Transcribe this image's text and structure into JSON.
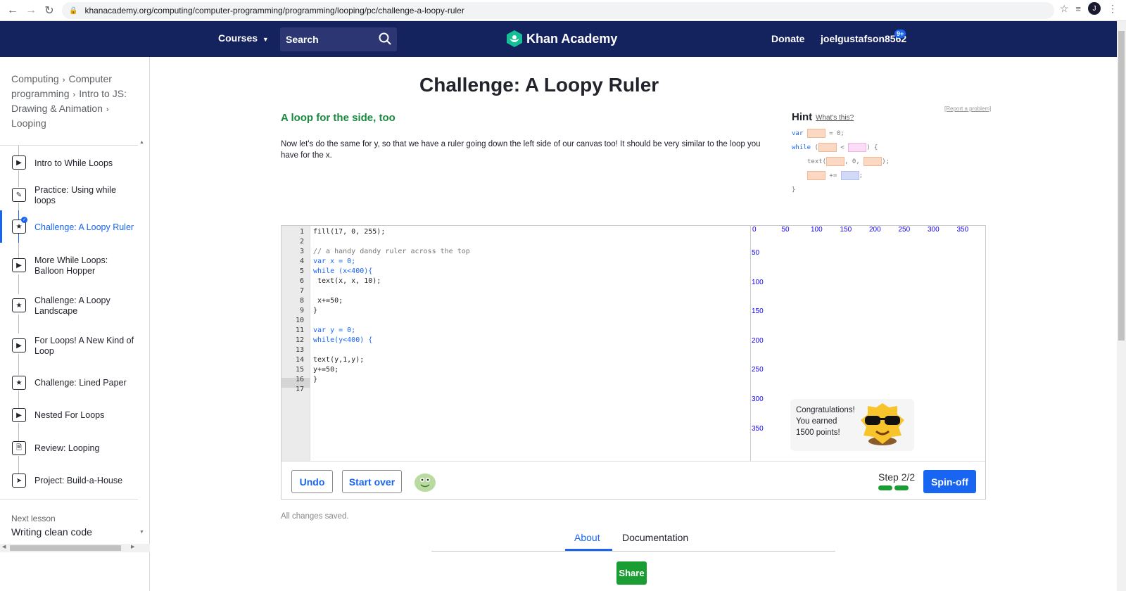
{
  "browser": {
    "url": "khanacademy.org/computing/computer-programming/programming/looping/pc/challenge-a-loopy-ruler",
    "profile_initial": "J"
  },
  "header": {
    "courses": "Courses",
    "search_placeholder": "Search",
    "logo": "Khan Academy",
    "donate": "Donate",
    "username": "joelgustafson8562",
    "notif_count": "9+"
  },
  "sidebar": {
    "breadcrumb": [
      "Computing",
      "Computer programming",
      "Intro to JS: Drawing & Animation",
      "Looping"
    ],
    "items": [
      {
        "label": "Intro to While Loops",
        "icon": "play-icon"
      },
      {
        "label": "Practice: Using while loops",
        "icon": "pencil-icon"
      },
      {
        "label": "Challenge: A Loopy Ruler",
        "icon": "star-icon"
      },
      {
        "label": "More While Loops: Balloon Hopper",
        "icon": "play-icon"
      },
      {
        "label": "Challenge: A Loopy Landscape",
        "icon": "star-icon"
      },
      {
        "label": "For Loops! A New Kind of Loop",
        "icon": "play-icon"
      },
      {
        "label": "Challenge: Lined Paper",
        "icon": "star-icon"
      },
      {
        "label": "Nested For Loops",
        "icon": "play-icon"
      },
      {
        "label": "Review: Looping",
        "icon": "document-icon"
      },
      {
        "label": "Project: Build-a-House",
        "icon": "rocket-icon"
      }
    ],
    "next_label": "Next lesson",
    "next_title": "Writing clean code"
  },
  "main": {
    "title": "Challenge: A Loopy Ruler",
    "subtitle": "A loop for the side, too",
    "description": "Now let's do the same for y, so that we have a ruler going down the left side of our canvas too! It should be very similar to the loop you have for the x.",
    "report": "[Report a problem]",
    "hint_title": "Hint",
    "hint_what": "What's this?",
    "hint_lines": {
      "l1_kw": "var",
      "l1_eq": "= 0;",
      "l2_kw": "while",
      "l2_open": "(",
      "l2_lt": "<",
      "l2_close": ") {",
      "l3_fn": "text(",
      "l3_mid": ", 0,",
      "l3_end": ");",
      "l4_op": "+=",
      "l4_end": ";",
      "l5": "}"
    }
  },
  "editor": {
    "lines": [
      "fill(17, 0, 255);",
      "",
      "// a handy dandy ruler across the top",
      "var x = 0;",
      "while (x<400){",
      " text(x, x, 10);",
      "",
      " x+=50;",
      "}",
      "",
      "var y = 0;",
      "while(y<400) {",
      "",
      "text(y,1,y);",
      "y+=50;",
      "}",
      ""
    ],
    "line_numbers": [
      "1",
      "2",
      "3",
      "4",
      "5",
      "6",
      "7",
      "8",
      "9",
      "10",
      "11",
      "12",
      "13",
      "14",
      "15",
      "16",
      "17"
    ],
    "canvas_x_ticks": [
      "0",
      "50",
      "100",
      "150",
      "200",
      "250",
      "300",
      "350"
    ],
    "canvas_y_ticks": [
      "50",
      "100",
      "150",
      "200",
      "250",
      "300",
      "350"
    ],
    "congrats_line1": "Congratulations!",
    "congrats_line2": "You earned",
    "congrats_line3": "1500 points!",
    "undo": "Undo",
    "start_over": "Start over",
    "step": "Step 2/2",
    "spinoff": "Spin-off"
  },
  "footer": {
    "saved": "All changes saved.",
    "tab_about": "About",
    "tab_docs": "Documentation",
    "share": "Share"
  },
  "colors": {
    "header_bg": "#14225e",
    "accent": "#1865f2",
    "green": "#1a9e33",
    "canvas_text": "#1100ff"
  }
}
